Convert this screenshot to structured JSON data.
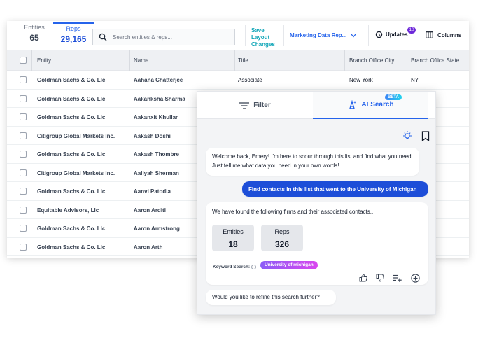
{
  "topbar": {
    "entities_label": "Entities",
    "entities_count": "65",
    "reps_label": "Reps",
    "reps_count": "29,165",
    "search_placeholder": "Search entities & reps...",
    "save_layout": "Save Layout Changes",
    "dataset": "Marketing Data Rep...",
    "updates_label": "Updates",
    "updates_badge": "10",
    "columns_label": "Columns"
  },
  "table": {
    "headers": [
      "Entity",
      "Name",
      "Title",
      "Branch Office City",
      "Branch Office State"
    ],
    "rows": [
      {
        "entity": "Goldman Sachs & Co. Llc",
        "name": "Aahana Chatterjee",
        "title": "Associate",
        "city": "New York",
        "state": "NY"
      },
      {
        "entity": "Goldman Sachs & Co. Llc",
        "name": "Aakanksha Sharma",
        "title": "",
        "city": "",
        "state": ""
      },
      {
        "entity": "Goldman Sachs & Co. Llc",
        "name": "Aakanxit Khullar",
        "title": "",
        "city": "",
        "state": ""
      },
      {
        "entity": "Citigroup Global Markets Inc.",
        "name": "Aakash Doshi",
        "title": "",
        "city": "",
        "state": ""
      },
      {
        "entity": "Goldman Sachs & Co. Llc",
        "name": "Aakash Thombre",
        "title": "",
        "city": "",
        "state": ""
      },
      {
        "entity": "Citigroup Global Markets Inc.",
        "name": "Aaliyah Sherman",
        "title": "",
        "city": "",
        "state": ""
      },
      {
        "entity": "Goldman Sachs & Co. Llc",
        "name": "Aanvi Patodia",
        "title": "",
        "city": "",
        "state": ""
      },
      {
        "entity": "Equitable Advisors, Llc",
        "name": "Aaron Arditi",
        "title": "",
        "city": "",
        "state": ""
      },
      {
        "entity": "Goldman Sachs & Co. Llc",
        "name": "Aaron Armstrong",
        "title": "",
        "city": "",
        "state": ""
      },
      {
        "entity": "Goldman Sachs & Co. Llc",
        "name": "Aaron Arth",
        "title": "",
        "city": "",
        "state": ""
      }
    ]
  },
  "panel": {
    "tab_filter": "Filter",
    "tab_ai": "AI Search",
    "beta": "BETA",
    "welcome": "Welcome back, Emery! I'm here to scour through this list and find what you need. Just tell me what data you need in your own words!",
    "user_query": "Find contacts in this list that went to the University of Michigan",
    "result_text": "We have found the following firms and their associated contacts...",
    "result_entities_label": "Entities",
    "result_entities": "18",
    "result_reps_label": "Reps",
    "result_reps": "326",
    "keyword_label": "Keyword Search:",
    "keyword_value": "University of michigan",
    "followup": "Would you like to refine this search further?"
  },
  "colors": {
    "accent": "#2563eb",
    "teal": "#0ea5b7",
    "badge": "#6d28d9"
  }
}
